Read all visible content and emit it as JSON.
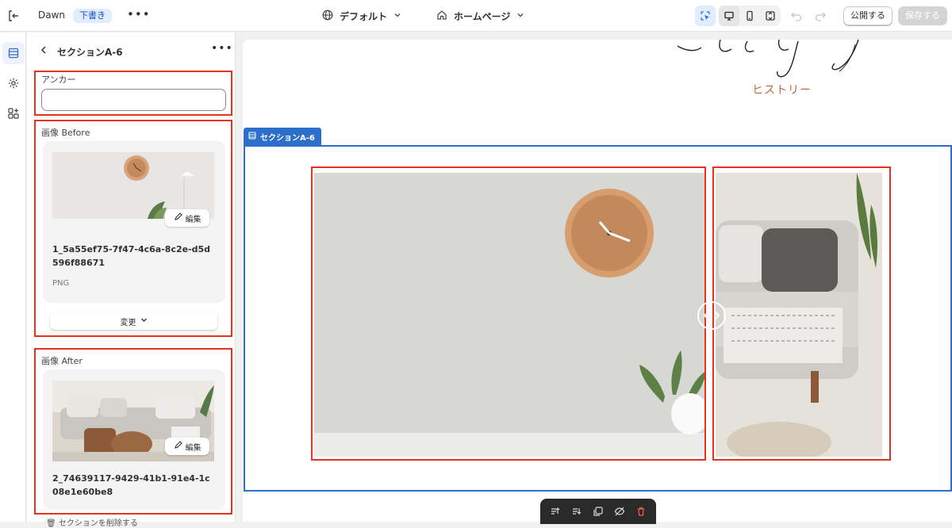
{
  "topbar": {
    "store_name": "Dawn",
    "status_badge": "下書き",
    "theme_select": "デフォルト",
    "page_select": "ホームページ",
    "publish_label": "公開する",
    "save_label": "保存する"
  },
  "sidebar": {
    "section_title": "セクションA-6",
    "anchor": {
      "label": "アンカー",
      "value": ""
    },
    "image_before": {
      "label": "画像 Before",
      "edit_label": "編集",
      "filename": "1_5a55ef75-7f47-4c6a-8c2e-d5d596f88671",
      "filetype": "PNG",
      "change_label": "変更"
    },
    "image_after": {
      "label": "画像 After",
      "edit_label": "編集",
      "filename": "2_74639117-9429-41b1-91e4-1c08e1e60be8"
    },
    "delete_label": "セクションを削除する"
  },
  "canvas": {
    "history_text": "ヒストリー",
    "section_tag": "セクションA-6"
  },
  "colors": {
    "accent": "#2c6ecb",
    "highlight": "#e63320",
    "history": "#b86b3e"
  }
}
